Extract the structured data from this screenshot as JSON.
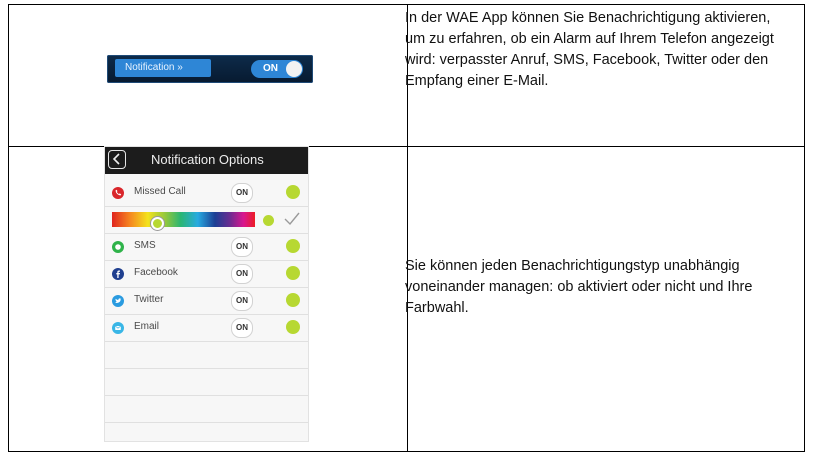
{
  "top_row": {
    "banner": {
      "label": "Notification »",
      "toggle": "ON",
      "colors": {
        "bar": "#071a30",
        "accent": "#2e86d6"
      }
    },
    "description": "In der WAE App können Sie Benachrichtigung aktivieren, um zu erfahren, ob ein Alarm auf Ihrem Telefon angezeigt wird: verpasster Anruf, SMS, Facebook, Twitter oder den Empfang einer E-Mail."
  },
  "bottom_row": {
    "phone": {
      "header_title": "Notification Options",
      "back_icon": "chevron-left-icon",
      "rows": [
        {
          "label": "Missed Call",
          "toggle": "ON",
          "icon": "phone-icon",
          "icon_color": "#d9262b",
          "dot_color": "#b7d832"
        },
        {
          "label": "SMS",
          "toggle": "ON",
          "icon": "sms-icon",
          "icon_color": "#2fb34a",
          "dot_color": "#b7d832"
        },
        {
          "label": "Facebook",
          "toggle": "ON",
          "icon": "facebook-icon",
          "icon_color": "#1f3f8f",
          "dot_color": "#b7d832"
        },
        {
          "label": "Twitter",
          "toggle": "ON",
          "icon": "twitter-icon",
          "icon_color": "#2a9be0",
          "dot_color": "#b7d832"
        },
        {
          "label": "Email",
          "toggle": "ON",
          "icon": "email-icon",
          "icon_color": "#39b6e6",
          "dot_color": "#b7d832"
        }
      ],
      "color_selector": {
        "selected_color": "#b7d832",
        "confirm_icon": "check-icon"
      }
    },
    "description": "Sie können jeden Benachrichtigungstyp unabhängig voneinander managen: ob aktiviert oder nicht und Ihre Farbwahl."
  }
}
